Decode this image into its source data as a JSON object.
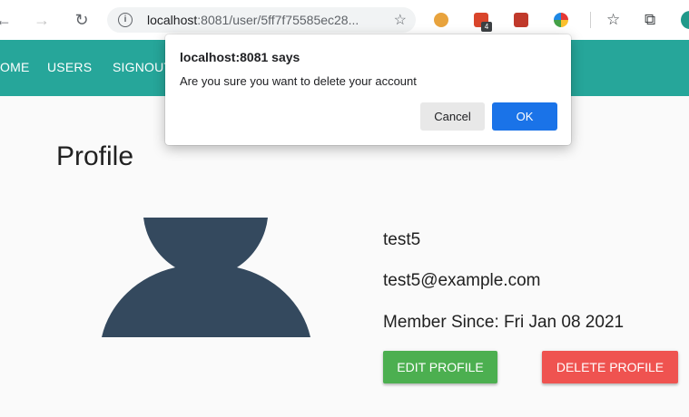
{
  "browser": {
    "url_host": "localhost",
    "url_rest": ":8081/user/5ff7f75585ec28...",
    "extension_badge": "4"
  },
  "nav": {
    "items": [
      "OME",
      "USERS",
      "SIGNOUT"
    ]
  },
  "page": {
    "title": "Profile",
    "username": "test5",
    "email": "test5@example.com",
    "member_since": "Member Since: Fri Jan 08 2021",
    "edit_label": "EDIT PROFILE",
    "delete_label": "DELETE PROFILE"
  },
  "dialog": {
    "title": "localhost:8081 says",
    "message": "Are you sure you want to delete your account",
    "cancel_label": "Cancel",
    "ok_label": "OK"
  },
  "colors": {
    "nav_bg": "#26a69a",
    "edit_button": "#4caf50",
    "delete_button": "#ef5350",
    "ok_button": "#1a73e8",
    "avatar": "#34495e"
  },
  "icons": {
    "back": "arrow-left-icon",
    "forward": "arrow-right-icon",
    "reload": "reload-icon",
    "info": "info-icon",
    "star": "star-icon",
    "reading_list": "reading-list-icon",
    "collections": "collections-icon"
  }
}
